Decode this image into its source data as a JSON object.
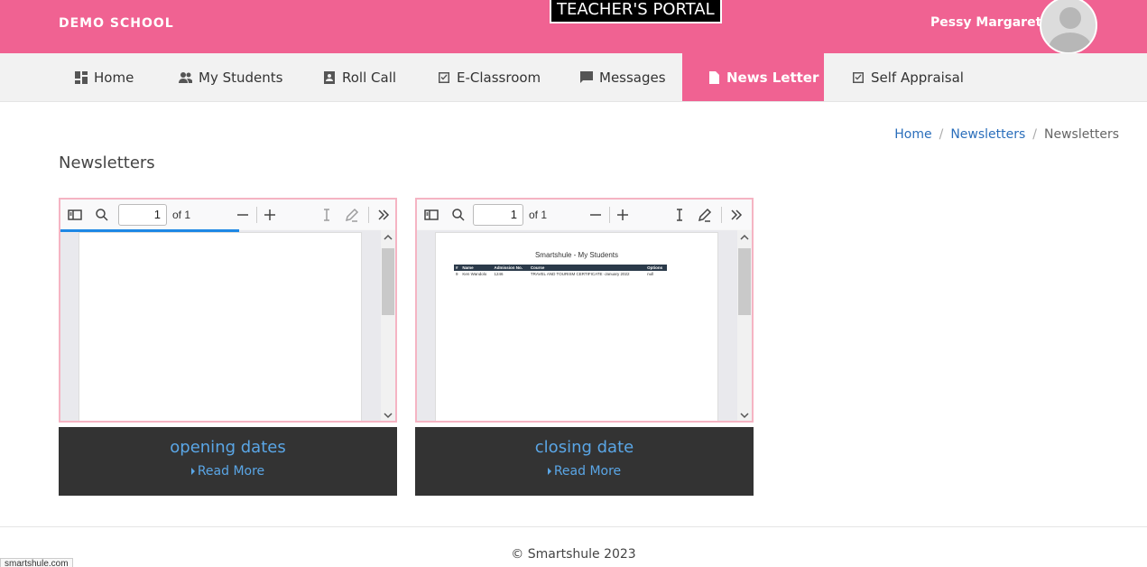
{
  "colors": {
    "accent": "#f06292",
    "link": "#2a6ebb",
    "card_footer": "#333333",
    "card_link": "#5aa6e6"
  },
  "header": {
    "brand": "DEMO SCHOOL",
    "portal": "TEACHER'S PORTAL",
    "user_name": "Pessy Margaret"
  },
  "nav": {
    "items": [
      {
        "label": "Home",
        "icon": "dashboard-icon",
        "active": false
      },
      {
        "label": "My Students",
        "icon": "people-icon",
        "active": false
      },
      {
        "label": "Roll Call",
        "icon": "contact-card-icon",
        "active": false
      },
      {
        "label": "E-Classroom",
        "icon": "checkbox-icon",
        "active": false
      },
      {
        "label": "Messages",
        "icon": "chat-icon",
        "active": false
      },
      {
        "label": "News Letter",
        "icon": "document-icon",
        "active": true
      },
      {
        "label": "Self Appraisal",
        "icon": "checkbox-icon",
        "active": false
      }
    ]
  },
  "breadcrumb": [
    "Home",
    "Newsletters",
    "Newsletters"
  ],
  "page_title": "Newsletters",
  "cards": [
    {
      "title": "opening dates",
      "read_more": "Read More",
      "viewer": {
        "page": "1",
        "page_of": "of 1",
        "loading": true
      }
    },
    {
      "title": "closing date",
      "read_more": "Read More",
      "viewer": {
        "page": "1",
        "page_of": "of 1",
        "loading": false,
        "doc_title": "Smartshule - My Students",
        "doc_headers": [
          "#",
          "Name",
          "Admission No.",
          "Course",
          "Options"
        ],
        "doc_row": [
          "9",
          "Ken Wandolo",
          "1246",
          "TRAVEL AND TOURISM CERTIFICATE -January 2022",
          "null"
        ]
      }
    }
  ],
  "footer": {
    "copyright": "© Smartshule 2023",
    "status_url": "smartshule.com"
  }
}
